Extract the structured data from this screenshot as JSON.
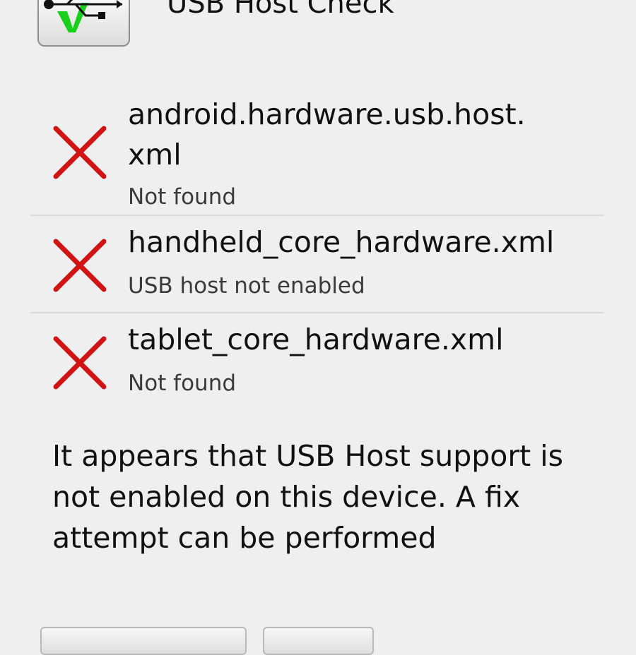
{
  "header": {
    "app_title": "USB Host Check",
    "app_icon": "usb-check-icon"
  },
  "colors": {
    "background": "#efefef",
    "fail_mark": "#d11313",
    "text_primary": "#111111",
    "text_secondary": "#3a3a3a"
  },
  "checks": [
    {
      "title_line1": "android.hardware.usb.host.",
      "title_line2": "xml",
      "status": "Not found",
      "icon": "red-x-icon"
    },
    {
      "title": "handheld_core_hardware.xml",
      "status": "USB host not enabled",
      "icon": "red-x-icon"
    },
    {
      "title": "tablet_core_hardware.xml",
      "status": "Not found",
      "icon": "red-x-icon"
    }
  ],
  "message": "It appears that USB Host support is not enabled on this device. A fix attempt can be performed",
  "buttons": {
    "primary_label": "",
    "secondary_label": ""
  }
}
